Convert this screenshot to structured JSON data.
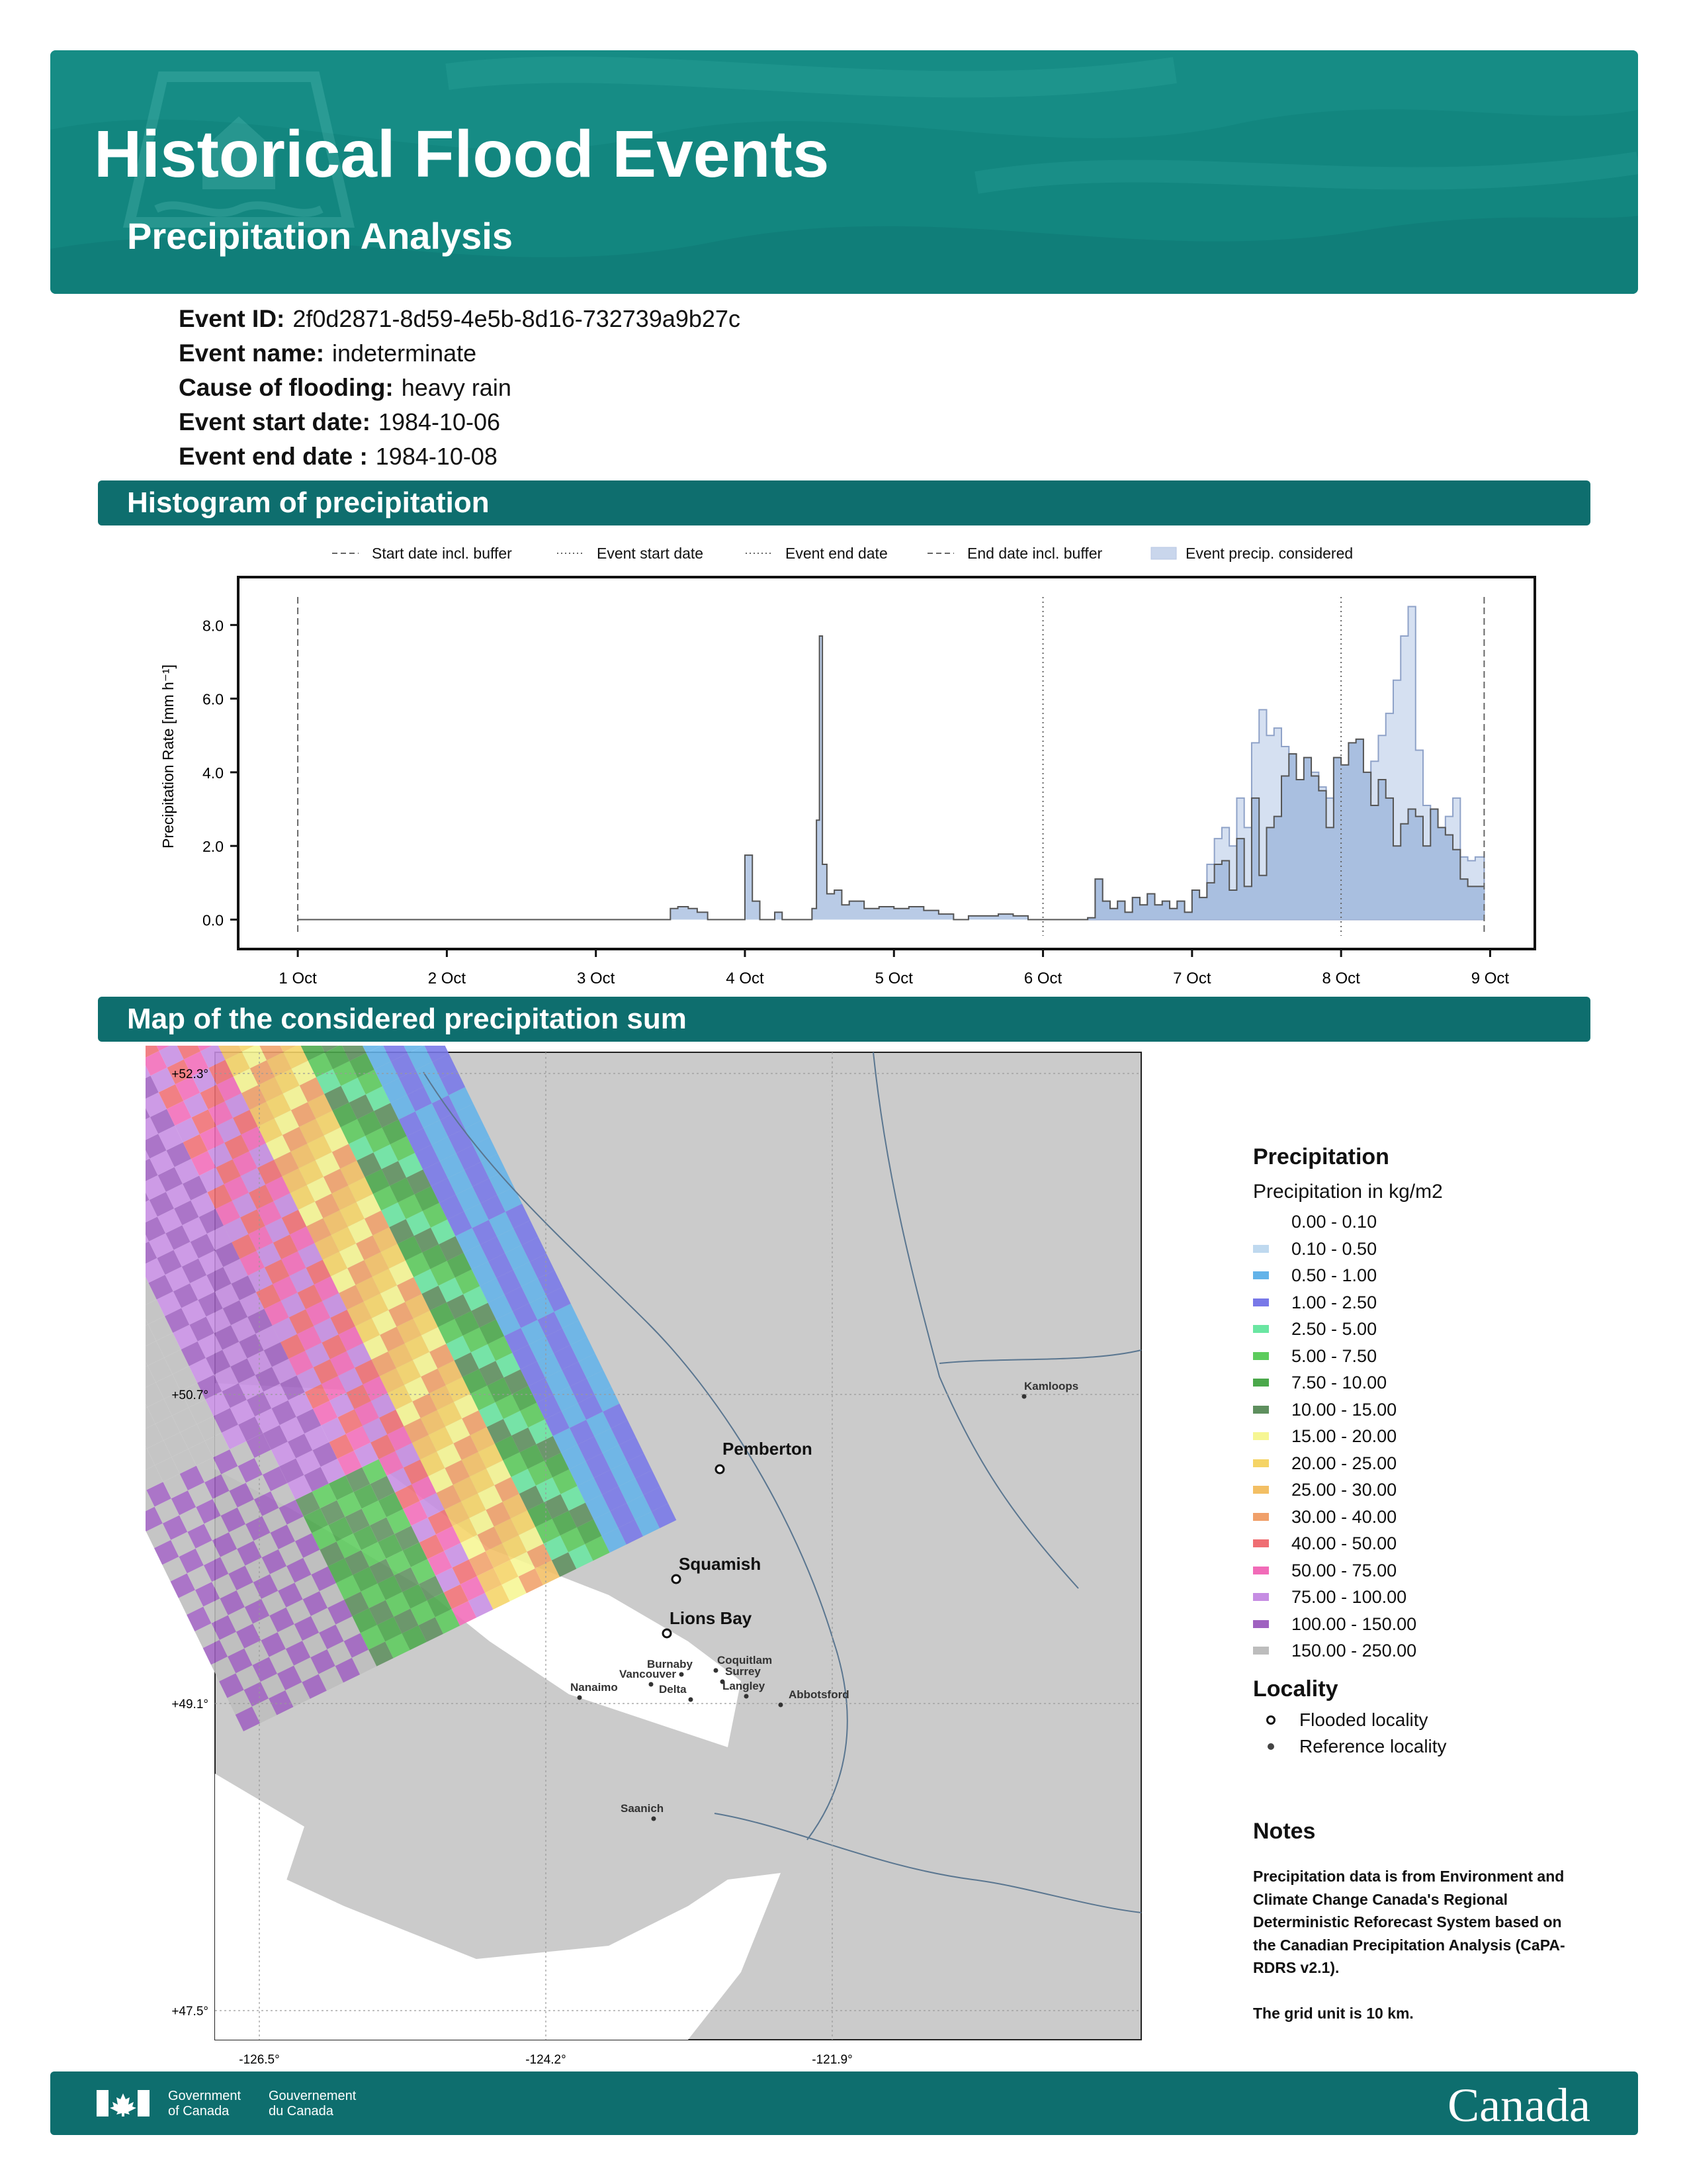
{
  "header": {
    "title": "Historical Flood Events",
    "subtitle": "Precipitation Analysis",
    "bg_color": "#12867f",
    "icon": "house-water-logo"
  },
  "event": {
    "rows": [
      {
        "label": "Event ID:",
        "value": "2f0d2871-8d59-4e5b-8d16-732739a9b27c"
      },
      {
        "label": "Event name:",
        "value": "indeterminate"
      },
      {
        "label": "Cause of flooding:",
        "value": "heavy rain"
      },
      {
        "label": "Event start date:",
        "value": "1984-10-06"
      },
      {
        "label": "Event end date :",
        "value": "1984-10-08"
      }
    ]
  },
  "sections": {
    "histogram": "Histogram of precipitation",
    "map": "Map of the considered precipitation sum"
  },
  "chart_data": [
    {
      "type": "area",
      "ylabel": "Precipitation Rate [mm h⁻¹]",
      "xlabel": "",
      "ylim": [
        -0.8,
        9.3
      ],
      "yticks": [
        "0.0",
        "2.0",
        "4.0",
        "6.0",
        "8.0"
      ],
      "xticks": [
        "1 Oct",
        "2 Oct",
        "3 Oct",
        "4 Oct",
        "5 Oct",
        "6 Oct",
        "7 Oct",
        "8 Oct",
        "9 Oct"
      ],
      "x_unit": "days since 1984-10-01 00:00",
      "legend_position": "top",
      "legend": [
        {
          "label": "Start date incl. buffer",
          "style": "dashed"
        },
        {
          "label": "Event start date",
          "style": "dotted"
        },
        {
          "label": "Event end date",
          "style": "dotted"
        },
        {
          "label": "End date incl. buffer",
          "style": "dashed"
        },
        {
          "label": "Event precip. considered",
          "style": "patch"
        }
      ],
      "vlines": [
        {
          "x": 0.0,
          "style": "dashed"
        },
        {
          "x": 5.0,
          "style": "dotted"
        },
        {
          "x": 7.0,
          "style": "dotted"
        },
        {
          "x": 7.96,
          "style": "dashed"
        }
      ],
      "series": [
        {
          "color": "#555555",
          "points": [
            [
              0,
              0
            ],
            [
              2.5,
              0
            ],
            [
              2.5,
              0.3
            ],
            [
              2.55,
              0.35
            ],
            [
              2.62,
              0.3
            ],
            [
              2.68,
              0.2
            ],
            [
              2.75,
              0
            ],
            [
              3.0,
              0
            ],
            [
              3.0,
              1.75
            ],
            [
              3.05,
              0.5
            ],
            [
              3.1,
              0
            ],
            [
              3.2,
              0.2
            ],
            [
              3.25,
              0
            ],
            [
              3.4,
              0
            ],
            [
              3.45,
              0.3
            ],
            [
              3.48,
              2.7
            ],
            [
              3.5,
              7.7
            ],
            [
              3.52,
              1.5
            ],
            [
              3.55,
              0.7
            ],
            [
              3.6,
              0.8
            ],
            [
              3.65,
              0.4
            ],
            [
              3.7,
              0.5
            ],
            [
              3.8,
              0.3
            ],
            [
              3.9,
              0.35
            ],
            [
              4.0,
              0.3
            ],
            [
              4.1,
              0.35
            ],
            [
              4.2,
              0.25
            ],
            [
              4.3,
              0.15
            ],
            [
              4.4,
              0
            ],
            [
              4.5,
              0.1
            ],
            [
              4.6,
              0.1
            ],
            [
              4.7,
              0.15
            ],
            [
              4.8,
              0.1
            ],
            [
              4.9,
              0
            ],
            [
              5.2,
              0
            ],
            [
              5.3,
              0.05
            ],
            [
              5.35,
              1.1
            ],
            [
              5.4,
              0.5
            ],
            [
              5.45,
              0.3
            ],
            [
              5.5,
              0.5
            ],
            [
              5.55,
              0.2
            ],
            [
              5.6,
              0.6
            ],
            [
              5.65,
              0.4
            ],
            [
              5.7,
              0.7
            ],
            [
              5.75,
              0.4
            ],
            [
              5.8,
              0.5
            ],
            [
              5.85,
              0.3
            ],
            [
              5.9,
              0.5
            ],
            [
              5.95,
              0.2
            ],
            [
              6.0,
              0.8
            ],
            [
              6.05,
              0.6
            ],
            [
              6.1,
              1.0
            ],
            [
              6.15,
              1.5
            ],
            [
              6.2,
              1.6
            ],
            [
              6.25,
              0.8
            ],
            [
              6.3,
              2.2
            ],
            [
              6.35,
              0.9
            ],
            [
              6.4,
              3.3
            ],
            [
              6.45,
              1.2
            ],
            [
              6.5,
              2.5
            ],
            [
              6.55,
              2.8
            ],
            [
              6.6,
              3.9
            ],
            [
              6.65,
              4.5
            ],
            [
              6.7,
              3.8
            ],
            [
              6.75,
              4.4
            ],
            [
              6.8,
              3.9
            ],
            [
              6.85,
              3.5
            ],
            [
              6.9,
              2.5
            ],
            [
              6.95,
              4.4
            ],
            [
              7.0,
              4.2
            ],
            [
              7.05,
              4.8
            ],
            [
              7.1,
              4.9
            ],
            [
              7.15,
              4.0
            ],
            [
              7.2,
              3.1
            ],
            [
              7.25,
              3.8
            ],
            [
              7.3,
              3.3
            ],
            [
              7.35,
              2.0
            ],
            [
              7.4,
              2.6
            ],
            [
              7.45,
              3.0
            ],
            [
              7.5,
              2.8
            ],
            [
              7.55,
              2.0
            ],
            [
              7.6,
              3.0
            ],
            [
              7.65,
              2.5
            ],
            [
              7.7,
              2.3
            ],
            [
              7.75,
              1.9
            ],
            [
              7.8,
              1.1
            ],
            [
              7.85,
              0.9
            ],
            [
              7.9,
              0.9
            ],
            [
              7.96,
              0.9
            ]
          ]
        },
        {
          "color": "#b0c4de",
          "points": [
            [
              5.0,
              0
            ],
            [
              5.3,
              0.05
            ],
            [
              5.35,
              1.1
            ],
            [
              5.4,
              0.5
            ],
            [
              5.45,
              0.3
            ],
            [
              5.5,
              0.5
            ],
            [
              5.55,
              0.2
            ],
            [
              5.6,
              0.6
            ],
            [
              5.65,
              0.4
            ],
            [
              5.7,
              0.7
            ],
            [
              5.75,
              0.4
            ],
            [
              5.8,
              0.5
            ],
            [
              5.85,
              0.3
            ],
            [
              5.9,
              0.5
            ],
            [
              5.95,
              0.2
            ],
            [
              6.0,
              0.8
            ],
            [
              6.05,
              0.6
            ],
            [
              6.1,
              1.5
            ],
            [
              6.15,
              2.2
            ],
            [
              6.2,
              2.5
            ],
            [
              6.25,
              2.0
            ],
            [
              6.3,
              3.3
            ],
            [
              6.35,
              2.5
            ],
            [
              6.4,
              4.8
            ],
            [
              6.45,
              5.7
            ],
            [
              6.5,
              5.0
            ],
            [
              6.55,
              5.2
            ],
            [
              6.6,
              4.7
            ],
            [
              6.65,
              4.5
            ],
            [
              6.7,
              3.0
            ],
            [
              6.75,
              3.4
            ],
            [
              6.8,
              4.0
            ],
            [
              6.85,
              3.6
            ],
            [
              6.9,
              3.3
            ],
            [
              6.95,
              3.2
            ],
            [
              7.0,
              3.0
            ],
            [
              7.05,
              2.9
            ],
            [
              7.1,
              3.1
            ],
            [
              7.15,
              3.4
            ],
            [
              7.2,
              4.3
            ],
            [
              7.25,
              5.0
            ],
            [
              7.3,
              5.6
            ],
            [
              7.35,
              6.5
            ],
            [
              7.4,
              7.7
            ],
            [
              7.45,
              8.5
            ],
            [
              7.5,
              4.6
            ],
            [
              7.55,
              3.1
            ],
            [
              7.6,
              2.8
            ],
            [
              7.65,
              2.3
            ],
            [
              7.7,
              2.8
            ],
            [
              7.75,
              3.3
            ],
            [
              7.8,
              1.7
            ],
            [
              7.85,
              1.6
            ],
            [
              7.9,
              1.7
            ],
            [
              7.96,
              1.8
            ]
          ]
        },
        {
          "color": "#8fa9d4",
          "points": [
            [
              5.0,
              0
            ],
            [
              5.3,
              0.05
            ],
            [
              5.35,
              1.1
            ],
            [
              5.4,
              0.5
            ],
            [
              5.45,
              0.3
            ],
            [
              5.5,
              0.5
            ],
            [
              5.55,
              0.2
            ],
            [
              5.6,
              0.6
            ],
            [
              5.65,
              0.4
            ],
            [
              5.7,
              0.7
            ],
            [
              5.75,
              0.4
            ],
            [
              5.8,
              0.5
            ],
            [
              5.85,
              0.3
            ],
            [
              5.9,
              0.5
            ],
            [
              5.95,
              0.2
            ],
            [
              6.0,
              0.8
            ],
            [
              6.05,
              0.6
            ],
            [
              6.1,
              1.0
            ],
            [
              6.15,
              1.5
            ],
            [
              6.2,
              1.6
            ],
            [
              6.25,
              0.8
            ],
            [
              6.3,
              2.2
            ],
            [
              6.35,
              0.9
            ],
            [
              6.4,
              3.3
            ],
            [
              6.45,
              1.2
            ],
            [
              6.5,
              2.5
            ],
            [
              6.55,
              2.8
            ],
            [
              6.6,
              3.9
            ],
            [
              6.65,
              4.5
            ],
            [
              6.7,
              3.8
            ],
            [
              6.75,
              4.4
            ],
            [
              6.8,
              3.9
            ],
            [
              6.85,
              3.5
            ],
            [
              6.9,
              2.5
            ],
            [
              6.95,
              4.4
            ],
            [
              7.0,
              4.2
            ],
            [
              7.05,
              4.8
            ],
            [
              7.1,
              4.9
            ],
            [
              7.15,
              4.0
            ],
            [
              7.2,
              3.1
            ],
            [
              7.25,
              3.8
            ],
            [
              7.3,
              3.3
            ],
            [
              7.35,
              2.0
            ],
            [
              7.4,
              2.6
            ],
            [
              7.45,
              3.0
            ],
            [
              7.5,
              2.8
            ],
            [
              7.55,
              2.0
            ],
            [
              7.6,
              3.0
            ],
            [
              7.65,
              2.5
            ],
            [
              7.7,
              2.3
            ],
            [
              7.75,
              1.9
            ],
            [
              7.8,
              1.1
            ],
            [
              7.85,
              0.9
            ],
            [
              7.9,
              0.9
            ],
            [
              7.96,
              0.9
            ]
          ]
        }
      ]
    }
  ],
  "map": {
    "lat_labels": [
      "+52.3°",
      "+50.7°",
      "+49.1°",
      "+47.5°"
    ],
    "lon_labels": [
      "-126.5°",
      "-124.2°",
      "-121.9°"
    ],
    "flooded_localities": [
      "Pemberton",
      "Squamish",
      "Lions Bay"
    ],
    "reference_localities": [
      "Kamloops",
      "Burnaby",
      "Coquitlam",
      "Vancouver",
      "Surrey",
      "Nanaimo",
      "Delta",
      "Langley",
      "Abbotsford",
      "Saanich"
    ]
  },
  "legend": {
    "title": "Precipitation",
    "subtitle": "Precipitation in kg/m2",
    "bins": [
      {
        "label": "0.00 - 0.10",
        "color": "#ffffff"
      },
      {
        "label": "0.10 - 0.50",
        "color": "#bfd9ef"
      },
      {
        "label": "0.50 - 1.00",
        "color": "#63b3e9"
      },
      {
        "label": "1.00 - 2.50",
        "color": "#7878e8"
      },
      {
        "label": "2.50 - 5.00",
        "color": "#6ae6a2"
      },
      {
        "label": "5.00 - 7.50",
        "color": "#5dcc5d"
      },
      {
        "label": "7.50 - 10.00",
        "color": "#4ba84b"
      },
      {
        "label": "10.00 - 15.00",
        "color": "#5e8f5e"
      },
      {
        "label": "15.00 - 20.00",
        "color": "#f6f693"
      },
      {
        "label": "20.00 - 25.00",
        "color": "#f5d466"
      },
      {
        "label": "25.00 - 30.00",
        "color": "#f3bf64"
      },
      {
        "label": "30.00 - 40.00",
        "color": "#f0a06a"
      },
      {
        "label": "40.00 - 50.00",
        "color": "#ef6e73"
      },
      {
        "label": "50.00 - 75.00",
        "color": "#f16bb8"
      },
      {
        "label": "75.00 - 100.00",
        "color": "#c68de3"
      },
      {
        "label": "100.00 - 150.00",
        "color": "#9f62c0"
      },
      {
        "label": "150.00 - 250.00",
        "color": "#bdbdbd"
      }
    ],
    "locality_title": "Locality",
    "flooded_label": "Flooded locality",
    "reference_label": "Reference locality"
  },
  "notes": {
    "title": "Notes",
    "lines": [
      "Precipitation data is from Environment and",
      "Climate Change Canada's Regional",
      "Deterministic Reforecast System based on",
      "the Canadian Precipitation Analysis (CaPA-",
      "RDRS v2.1).",
      "",
      "The grid unit is 10 km."
    ]
  },
  "footer": {
    "gov_en_1": "Government",
    "gov_en_2": "of Canada",
    "gov_fr_1": "Gouvernement",
    "gov_fr_2": "du Canada",
    "wordmark": "Canada",
    "flag_icon": "canada-flag-icon"
  }
}
